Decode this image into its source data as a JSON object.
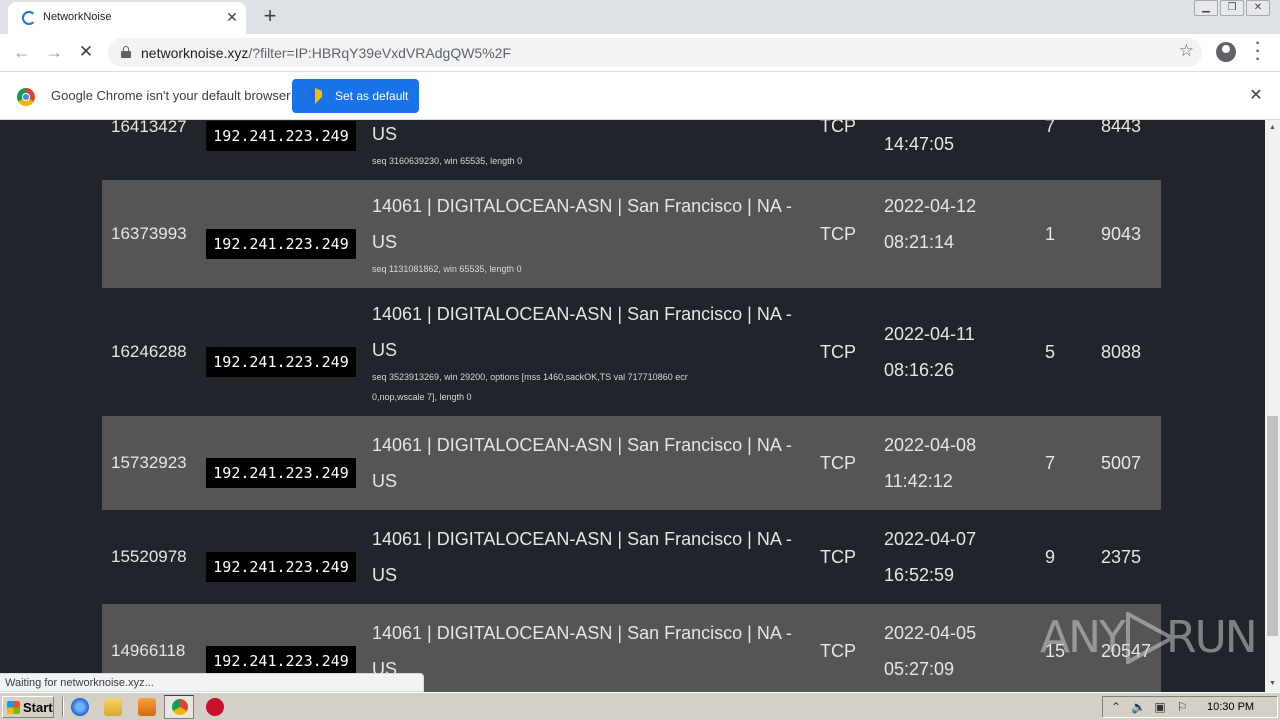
{
  "browser": {
    "tab_title": "NetworkNoise",
    "url_host": "networknoise.xyz",
    "url_rest": "/?filter=IP:HBRqY39eVxdVRAdgQW5%2F",
    "window_buttons": [
      "minimize-icon",
      "restore-icon",
      "close-icon"
    ]
  },
  "infobar": {
    "message": "Google Chrome isn't your default browser",
    "button_label": "Set as default"
  },
  "rows": [
    {
      "id": "16413427",
      "ip": "192.241.223.249",
      "asn_line2": "US",
      "detail": "seq 3160639230, win 65535, length 0",
      "protocol": "TCP",
      "date_time": "14:47:05",
      "count": "7",
      "port": "8443"
    },
    {
      "id": "16373993",
      "ip": "192.241.223.249",
      "asn_line1": "14061 | DIGITALOCEAN-ASN | San Francisco | NA -",
      "asn_line2": "US",
      "detail": "seq 1131081862, win 65535, length 0",
      "protocol": "TCP",
      "date": "2022-04-12",
      "time": "08:21:14",
      "count": "1",
      "port": "9043"
    },
    {
      "id": "16246288",
      "ip": "192.241.223.249",
      "asn_line1": "14061 | DIGITALOCEAN-ASN | San Francisco | NA -",
      "asn_line2": "US",
      "detail_line1": "seq 3523913269, win 29200, options [mss 1460,sackOK,TS val 717710860 ecr",
      "detail_line2": "0,nop,wscale 7], length 0",
      "protocol": "TCP",
      "date": "2022-04-11",
      "time": "08:16:26",
      "count": "5",
      "port": "8088"
    },
    {
      "id": "15732923",
      "ip": "192.241.223.249",
      "asn_line1": "14061 | DIGITALOCEAN-ASN | San Francisco | NA -",
      "asn_line2": "US",
      "protocol": "TCP",
      "date": "2022-04-08",
      "time": "11:42:12",
      "count": "7",
      "port": "5007"
    },
    {
      "id": "15520978",
      "ip": "192.241.223.249",
      "asn_line1": "14061 | DIGITALOCEAN-ASN | San Francisco | NA -",
      "asn_line2": "US",
      "protocol": "TCP",
      "date": "2022-04-07",
      "time": "16:52:59",
      "count": "9",
      "port": "2375"
    },
    {
      "id": "14966118",
      "ip": "192.241.223.249",
      "asn_line1": "14061 | DIGITALOCEAN-ASN | San Francisco | NA -",
      "asn_line2": "US",
      "protocol": "TCP",
      "date": "2022-04-05",
      "time": "05:27:09",
      "count": "15",
      "port": "20547"
    }
  ],
  "status_bar": "Waiting for networknoise.xyz...",
  "watermark": {
    "left": "ANY",
    "right": "RUN"
  },
  "taskbar": {
    "start_label": "Start",
    "clock": "10:30 PM"
  }
}
